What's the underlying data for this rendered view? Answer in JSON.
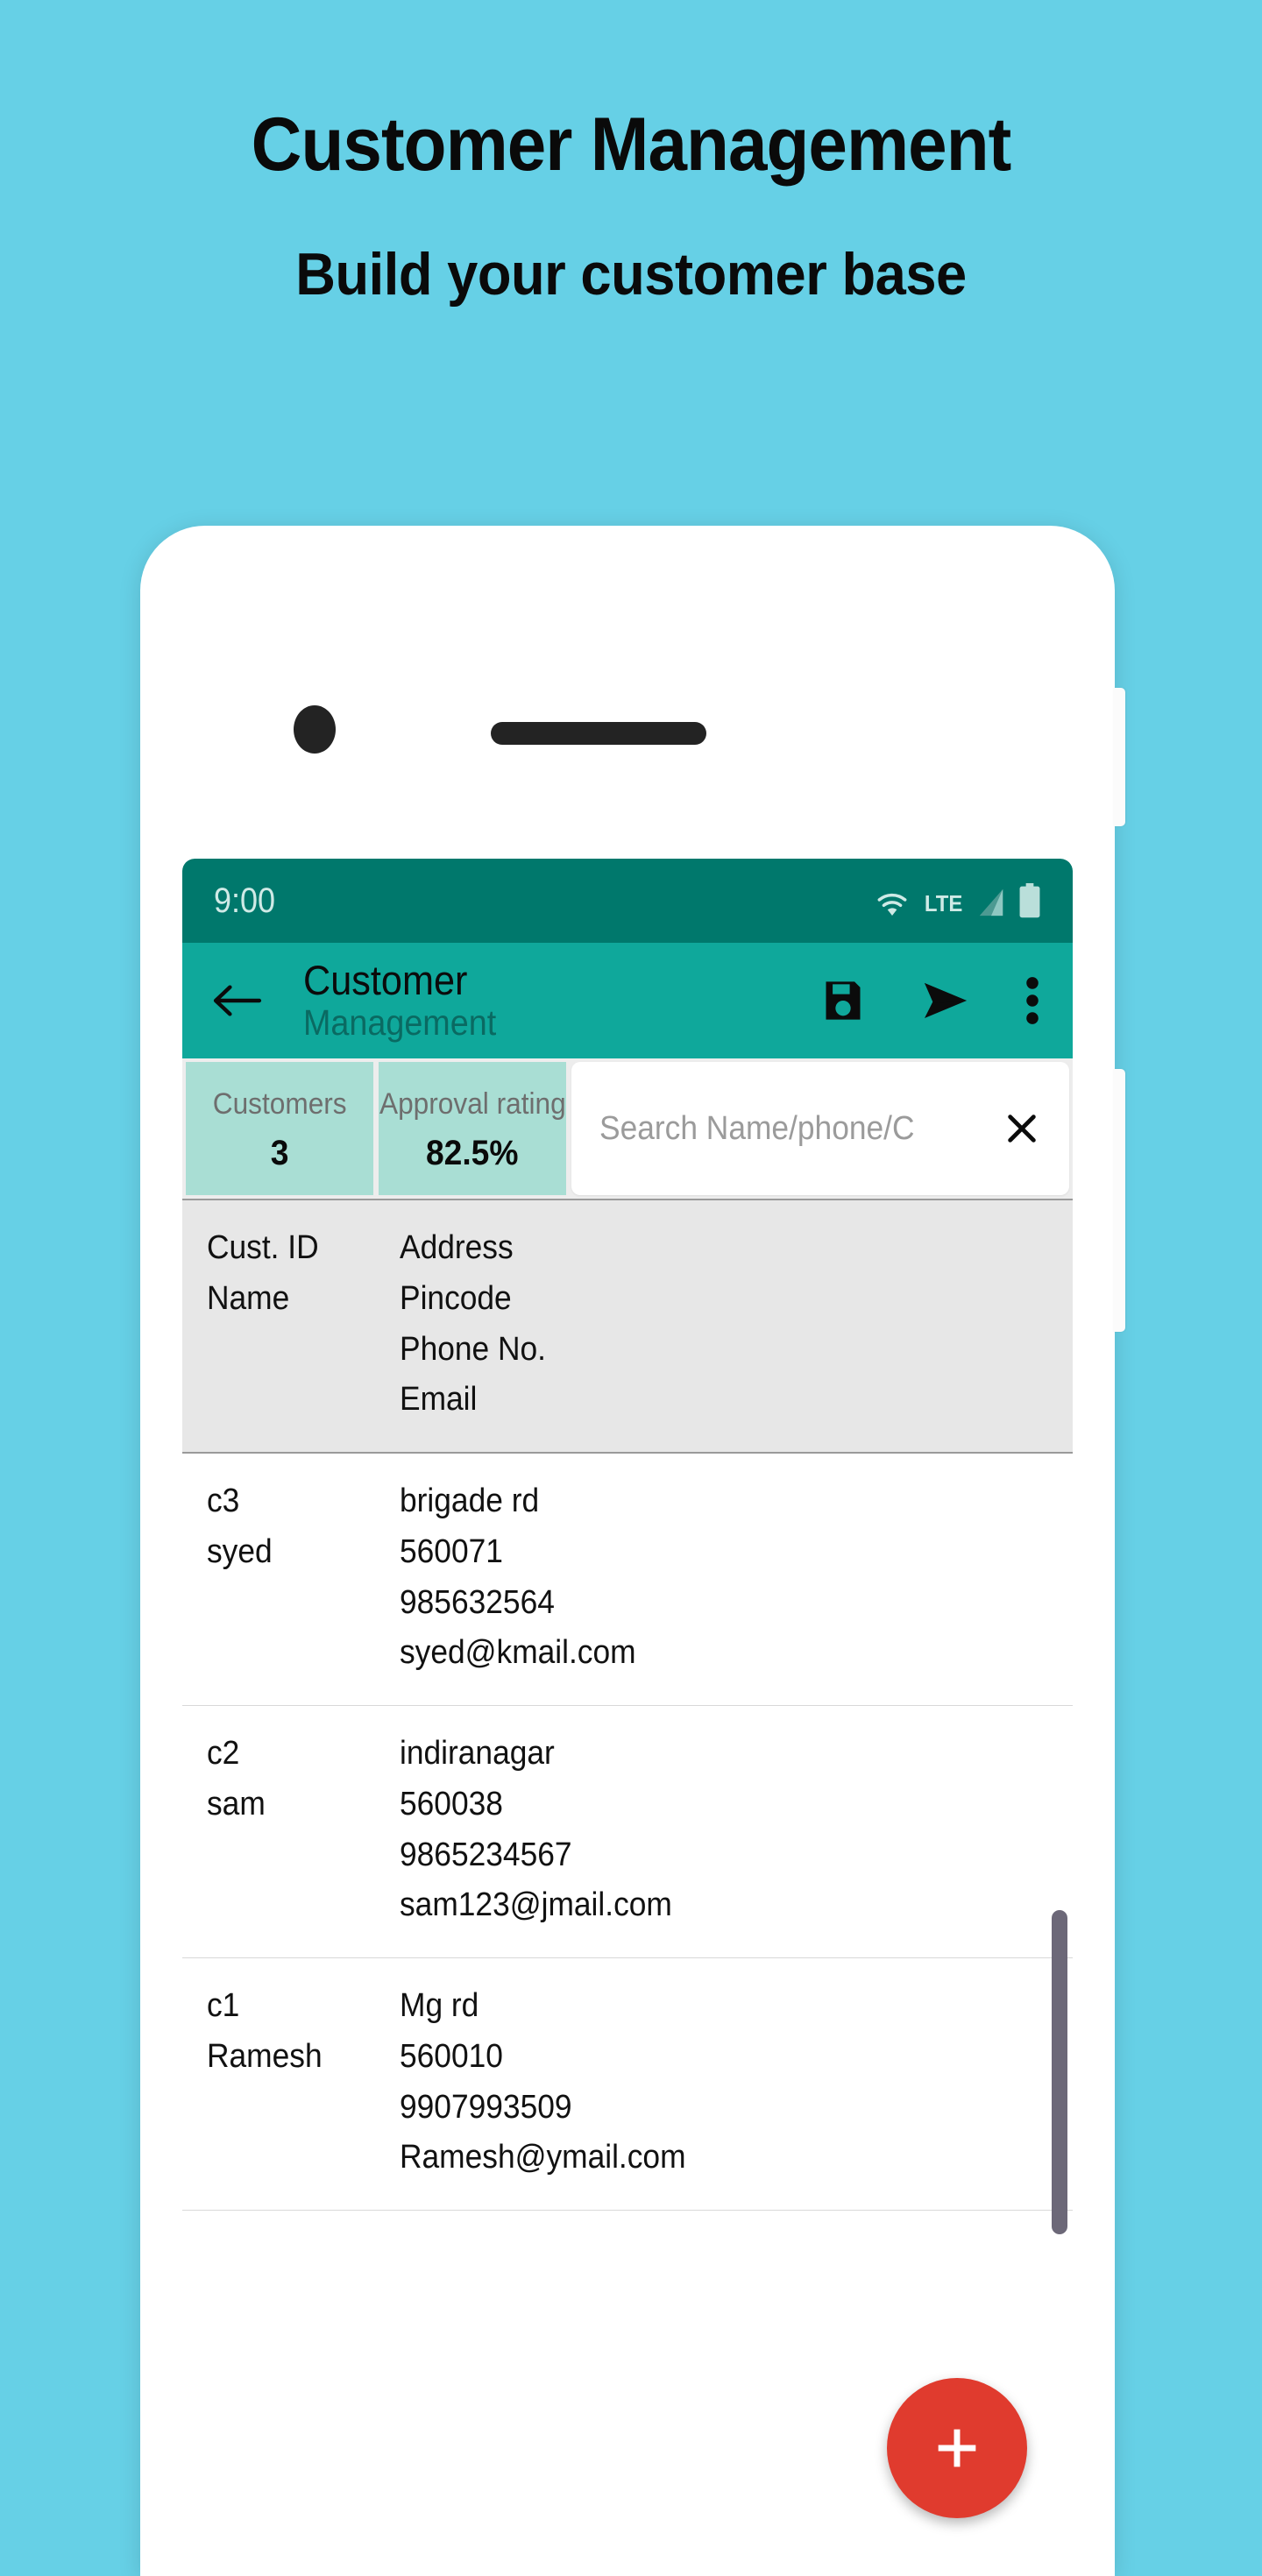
{
  "promo": {
    "title": "Customer Management",
    "subtitle": "Build your customer base",
    "background_color": "#66D0E6"
  },
  "phone": {
    "camera_icon": "camera-dot",
    "speaker_icon": "speaker-grill"
  },
  "status_bar": {
    "time": "9:00",
    "network_label": "LTE",
    "wifi_icon": "wifi-icon",
    "signal_icon": "signal-icon",
    "battery_icon": "battery-icon",
    "background_color": "#00786C"
  },
  "app_bar": {
    "back_icon": "arrow-left-icon",
    "title": "Customer",
    "subtitle": "Management",
    "save_icon": "save-icon",
    "send_icon": "send-icon",
    "more_icon": "more-vertical-icon",
    "background_color": "#0FA89B"
  },
  "stats": [
    {
      "label": "Customers",
      "value": "3"
    },
    {
      "label": "Approval rating",
      "value": "82.5%"
    }
  ],
  "search": {
    "value": "",
    "placeholder": "Search Name/phone/C",
    "clear_icon": "close-icon"
  },
  "table": {
    "header": {
      "left": [
        "Cust. ID",
        "Name"
      ],
      "right": [
        "Address",
        "Pincode",
        "Phone No.",
        "Email"
      ]
    },
    "rows": [
      {
        "left": [
          "c3",
          "syed"
        ],
        "right": [
          "brigade rd",
          "560071",
          "985632564",
          "syed@kmail.com"
        ]
      },
      {
        "left": [
          "c2",
          "sam"
        ],
        "right": [
          "indiranagar",
          "560038",
          "9865234567",
          "sam123@jmail.com"
        ]
      },
      {
        "left": [
          "c1",
          "Ramesh"
        ],
        "right": [
          "Mg rd",
          "560010",
          "9907993509",
          "Ramesh@ymail.com"
        ]
      }
    ]
  },
  "fab": {
    "icon": "plus-icon",
    "color": "#E03B2E"
  }
}
